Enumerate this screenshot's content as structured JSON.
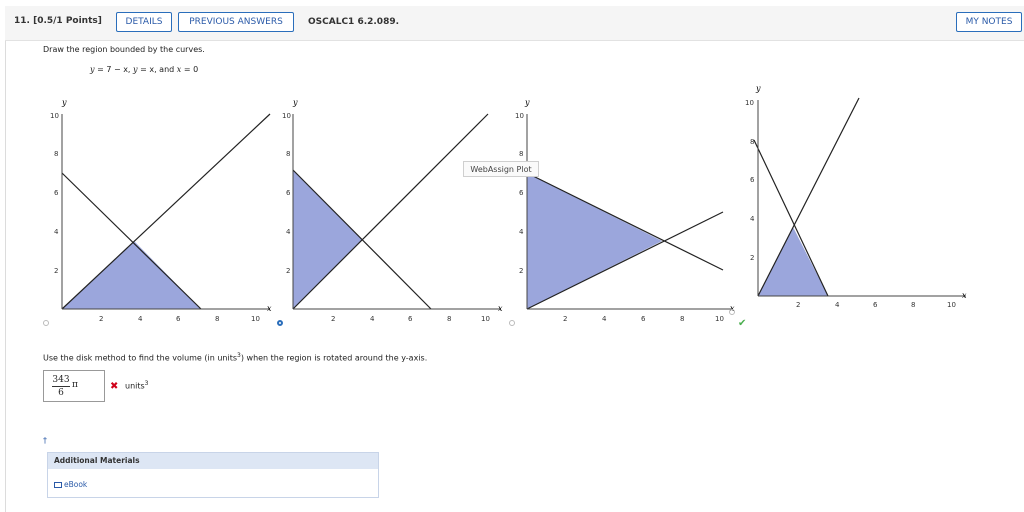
{
  "question": {
    "number": "11. [0.5/1 Points]",
    "buttons": {
      "details": "DETAILS",
      "previous_answers": "PREVIOUS ANSWERS",
      "my_notes": "MY NOTES"
    },
    "code": "OSCALC1 6.2.089."
  },
  "prompt": "Draw the region bounded by the curves.",
  "equation": {
    "part1": "y",
    "part2": " = 7 − x, ",
    "part3": "y",
    "part4": " = x, and ",
    "part5": "x",
    "part6": " = 0"
  },
  "plots": {
    "tooltip": "WebAssign Plot",
    "correct_choice": 4,
    "axis_labels": {
      "x": "x",
      "y": "y"
    },
    "ticks_x": [
      "2",
      "4",
      "6",
      "8",
      "10"
    ],
    "ticks_y": [
      "2",
      "4",
      "6",
      "8",
      "10"
    ],
    "colors": {
      "fill": "#9ba6dc",
      "line": "#222222",
      "correct": "#4caf50",
      "selected_radio": "#2a6ebb"
    }
  },
  "part2": {
    "text_before": "Use the disk method to find the volume (in units",
    "sup": "3",
    "text_after": ") when the region is rotated around the y-axis.",
    "answer_num": "343",
    "answer_den": "6",
    "answer_pi": "π",
    "units": "units",
    "units_sup": "3",
    "status": "incorrect"
  },
  "dagger": "†",
  "materials": {
    "title": "Additional Materials",
    "ebook": "eBook"
  }
}
